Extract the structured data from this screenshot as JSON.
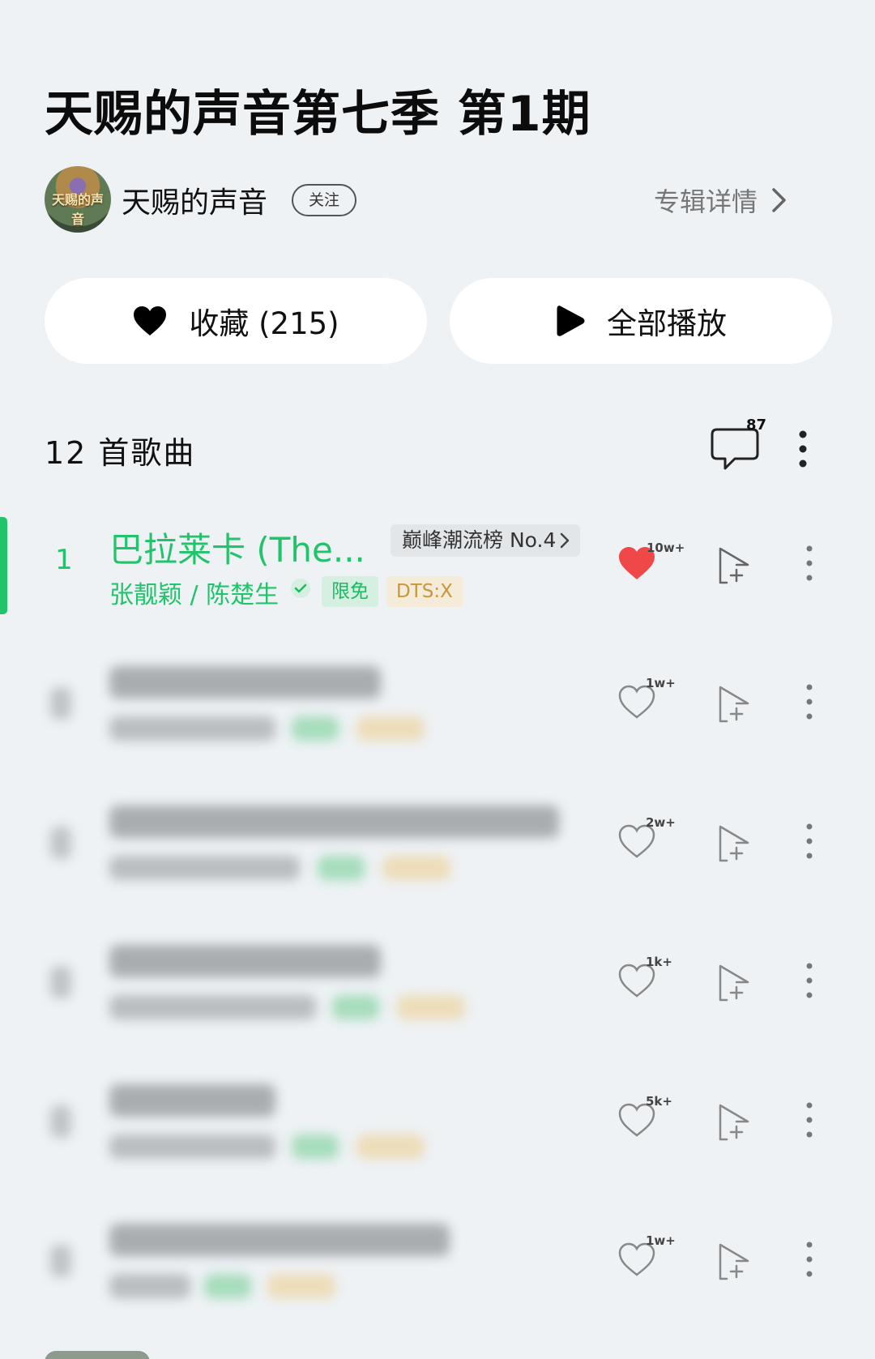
{
  "album": {
    "title": "天赐的声音第七季 第1期"
  },
  "artist": {
    "name": "天赐的声音",
    "avatar_text": "天赐的声音",
    "follow_label": "关注",
    "detail_label": "专辑详情"
  },
  "actions": {
    "favorite_label": "收藏 (215)",
    "play_all_label": "全部播放"
  },
  "list": {
    "count_label": "12 首歌曲",
    "comment_count": "87"
  },
  "songs": [
    {
      "index": "1",
      "title": "巴拉莱卡 (The...",
      "chart_tag": "巅峰潮流榜 No.4",
      "artists": "张靓颖 / 陈楚生",
      "tag_free": "限免",
      "tag_quality": "DTS:X",
      "likes": "10w+",
      "liked": true
    },
    {
      "likes": "1w+"
    },
    {
      "likes": "2w+"
    },
    {
      "likes": "1k+"
    },
    {
      "likes": "5k+"
    },
    {
      "likes": "1w+"
    }
  ],
  "colors": {
    "accent": "#21c46a",
    "like_active": "#f04848",
    "background": "#eef2f5"
  },
  "icons": [
    "heart-icon",
    "play-icon",
    "comment-icon",
    "more-vertical-icon",
    "add-to-playlist-icon",
    "verified-icon",
    "chevron-right-icon"
  ]
}
